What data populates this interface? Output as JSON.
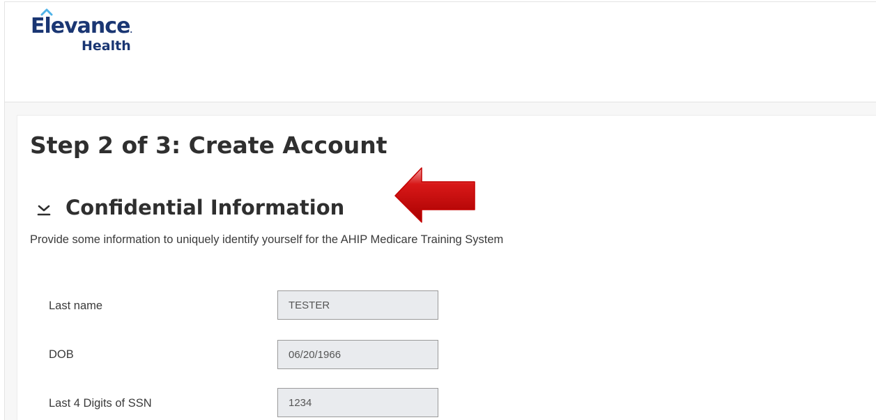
{
  "brand": {
    "name": "Elevance",
    "sub": "Health",
    "color": "#1a3673",
    "accent": "#4fb3e8"
  },
  "page": {
    "step_title": "Step 2 of 3: Create Account"
  },
  "section": {
    "title": "Confidential Information",
    "toggle_icon": "chevron-down-icon",
    "description": "Provide some information to uniquely identify yourself for the AHIP Medicare Training System"
  },
  "annotation": {
    "icon": "red-arrow-icon",
    "color": "#cc0000"
  },
  "fields": [
    {
      "label": "Last name",
      "value": "TESTER"
    },
    {
      "label": "DOB",
      "value": "06/20/1966"
    },
    {
      "label": "Last 4 Digits of SSN",
      "value": "1234"
    }
  ]
}
